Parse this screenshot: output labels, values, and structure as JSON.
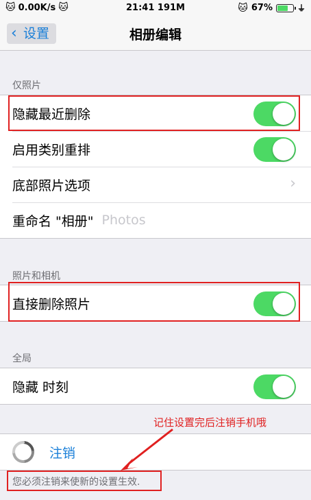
{
  "status_bar": {
    "network_speed": "0.00K/s",
    "time_and_memory": "21:41 191M",
    "battery_percent": "67%",
    "battery_level": 0.67,
    "cat_icon": "cat-emoticon-icon"
  },
  "nav": {
    "back_label": "设置",
    "title": "相册编辑"
  },
  "sections": {
    "photos_only": {
      "header": "仅照片",
      "hide_recently_deleted": "隐藏最近删除",
      "enable_category_reorder": "启用类别重排",
      "bottom_photo_options": "底部照片选项",
      "rename_album_label": "重命名 \"相册\"",
      "rename_album_placeholder": "Photos"
    },
    "photos_and_camera": {
      "header": "照片和相机",
      "delete_photos_directly": "直接删除照片"
    },
    "global": {
      "header": "全局",
      "hide_moments": "隐藏 时刻"
    }
  },
  "logout": {
    "label": "注销",
    "note": "您必须注销来使新的设置生效."
  },
  "annotation": {
    "text": "记住设置完后注销手机哦",
    "color": "#e02020"
  },
  "colors": {
    "toggle_on": "#4cd964",
    "link_blue": "#1a7fd8"
  }
}
